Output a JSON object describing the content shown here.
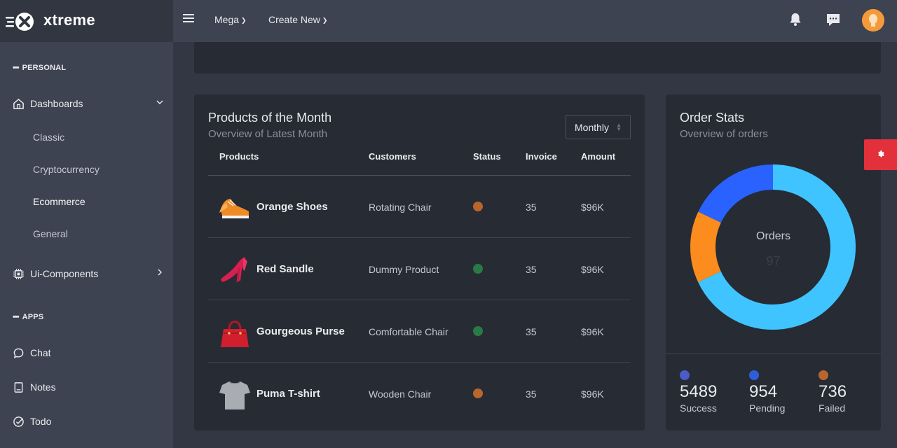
{
  "brand": {
    "name": "xtreme"
  },
  "header": {
    "nav": [
      {
        "label": "Mega"
      },
      {
        "label": "Create New"
      }
    ],
    "icons": [
      "menu-icon",
      "bell-icon",
      "message-icon",
      "user-avatar"
    ]
  },
  "sidebar": {
    "sections": [
      {
        "label": "PERSONAL"
      },
      {
        "label": "APPS"
      }
    ],
    "items": [
      {
        "label": "Dashboards",
        "icon": "home-icon"
      },
      {
        "label": "Ui-Components",
        "icon": "chip-icon"
      },
      {
        "label": "Chat",
        "icon": "chat-icon"
      },
      {
        "label": "Notes",
        "icon": "notes-icon"
      },
      {
        "label": "Todo",
        "icon": "check-circle-icon"
      }
    ],
    "sub_items": [
      {
        "label": "Classic"
      },
      {
        "label": "Cryptocurrency"
      },
      {
        "label": "Ecommerce",
        "active": true
      },
      {
        "label": "General"
      }
    ]
  },
  "products_card": {
    "title": "Products of the Month",
    "subtitle": "Overview of Latest Month",
    "period_select": "Monthly",
    "columns": [
      "Products",
      "Customers",
      "Status",
      "Invoice",
      "Amount"
    ],
    "rows": [
      {
        "product": "Orange Shoes",
        "customer": "Rotating Chair",
        "status_color": "#b9652c",
        "invoice": "35",
        "amount": "$96K",
        "image": "shoe-image"
      },
      {
        "product": "Red Sandle",
        "customer": "Dummy Product",
        "status_color": "#2a7a45",
        "invoice": "35",
        "amount": "$96K",
        "image": "heel-image"
      },
      {
        "product": "Gourgeous Purse",
        "customer": "Comfortable Chair",
        "status_color": "#2a7a45",
        "invoice": "35",
        "amount": "$96K",
        "image": "purse-image"
      },
      {
        "product": "Puma T-shirt",
        "customer": "Wooden Chair",
        "status_color": "#b9652c",
        "invoice": "35",
        "amount": "$96K",
        "image": "tshirt-image"
      }
    ]
  },
  "orders_card": {
    "title": "Order Stats",
    "subtitle": "Overview of orders",
    "center_label": "Orders",
    "center_value": "97",
    "stats": [
      {
        "value": "5489",
        "label": "Success",
        "color": "#4a5cc7"
      },
      {
        "value": "954",
        "label": "Pending",
        "color": "#2f5fd8"
      },
      {
        "value": "736",
        "label": "Failed",
        "color": "#b9652c"
      }
    ],
    "donut_segments": [
      {
        "color": "#40c4ff",
        "fraction": 0.68
      },
      {
        "color": "#fb8c1d",
        "fraction": 0.14
      },
      {
        "color": "#2962ff",
        "fraction": 0.18
      }
    ]
  },
  "colors": {
    "accent_red": "#e2313a",
    "card_bg": "#272b34",
    "sidebar_bg": "#3d4351"
  }
}
